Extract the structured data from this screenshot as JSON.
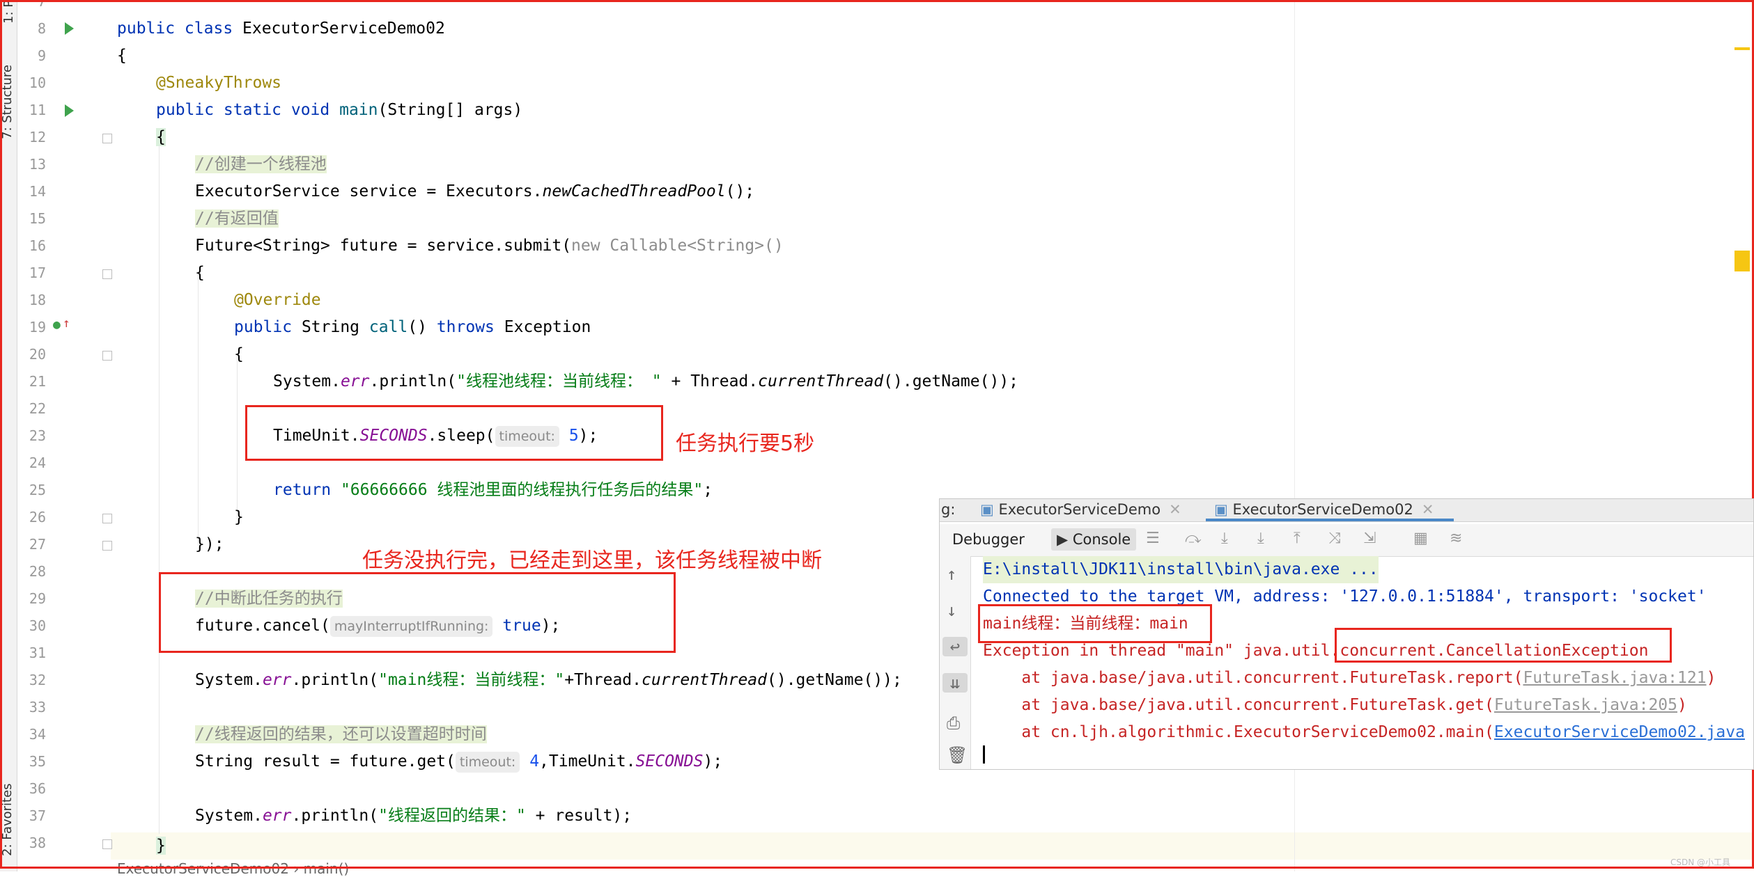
{
  "side_tabs": {
    "project": "1: P",
    "structure": "7: Structure",
    "favorites": "2: Favorites"
  },
  "line_numbers": [
    "7",
    "8",
    "9",
    "10",
    "11",
    "12",
    "13",
    "14",
    "15",
    "16",
    "17",
    "18",
    "19",
    "20",
    "21",
    "22",
    "23",
    "24",
    "25",
    "26",
    "27",
    "28",
    "29",
    "30",
    "31",
    "32",
    "33",
    "34",
    "35",
    "36",
    "37",
    "38"
  ],
  "code": {
    "l8": {
      "kw": "public class ",
      "name": "ExecutorServiceDemo02"
    },
    "l9": "{",
    "l10": "@SneakyThrows",
    "l11": {
      "kw": "public static void ",
      "name": "main",
      "rest": "(String[] args)"
    },
    "l12": "{",
    "l13": "//创建一个线程池",
    "l14": {
      "a": "ExecutorService service = Executors.",
      "b": "newCachedThreadPool",
      "c": "();"
    },
    "l15": "//有返回值",
    "l16": {
      "a": "Future<String> future = service.submit(",
      "b": "new Callable<String>()",
      "c": ""
    },
    "l17": "{",
    "l18": "@Override",
    "l19": {
      "kw": "public ",
      "a": "String ",
      "name": "call",
      "b": "() ",
      "kw2": "throws ",
      "c": "Exception"
    },
    "l20": "{",
    "l21": {
      "a": "System.",
      "b": "err",
      "c": ".println(",
      "str": "\"线程池线程：当前线程： \"",
      "d": " + Thread.",
      "e": "currentThread",
      "f": "().getName());"
    },
    "l23": {
      "a": "TimeUnit.",
      "b": "SECONDS",
      "c": ".sleep(",
      "hint": "timeout:",
      "num": "5",
      "d": ");"
    },
    "l25": {
      "kw": "return ",
      "str": "\"66666666 线程池里面的线程执行任务后的结果\"",
      "d": ";"
    },
    "l26": "}",
    "l27": "});",
    "l29": "//中断此任务的执行",
    "l30": {
      "a": "future.cancel(",
      "hint": "mayInterruptIfRunning:",
      "kw": "true",
      "d": ");"
    },
    "l32": {
      "a": "System.",
      "b": "err",
      "c": ".println(",
      "str": "\"main线程：当前线程：\"",
      "d": "+Thread.",
      "e": "currentThread",
      "f": "().getName());"
    },
    "l34": "//线程返回的结果，还可以设置超时时间",
    "l35": {
      "a": "String result = future.get(",
      "hint": "timeout:",
      "num": "4",
      "c": ",TimeUnit.",
      "b": "SECONDS",
      "d": ");"
    },
    "l37": {
      "a": "System.",
      "b": "err",
      "c": ".println(",
      "str": "\"线程返回的结果：\"",
      "d": " + result);"
    },
    "l38": "}"
  },
  "annotations": {
    "sleep_note": "任务执行要5秒",
    "cancel_note": "任务没执行完，已经走到这里，该任务线程被中断"
  },
  "breadcrumb": "ExecutorServiceDemo02 › main()",
  "debug": {
    "tabs": [
      {
        "label": "ExecutorServiceDemo"
      },
      {
        "label": "ExecutorServiceDemo02"
      }
    ],
    "tab_prefix": "g:",
    "toolbar": {
      "debugger": "Debugger",
      "console": "Console"
    },
    "console_lines": {
      "cmd": "E:\\install\\JDK11\\install\\bin\\java.exe ...",
      "connected": "Connected to the target VM, address: '127.0.0.1:51884', transport: 'socket'",
      "main_thread": "main线程：当前线程：main",
      "exception": "Exception in thread \"main\" java.util.concurrent.CancellationException",
      "at1_a": "    at java.base/java.util.concurrent.FutureTask.report(",
      "at1_link": "FutureTask.java:121",
      "at1_b": ")",
      "at2_a": "    at java.base/java.util.concurrent.FutureTask.get(",
      "at2_link": "FutureTask.java:205",
      "at2_b": ")",
      "at3_a": "    at cn.ljh.algorithmic.ExecutorServiceDemo02.main(",
      "at3_link": "ExecutorServiceDemo02.java"
    }
  },
  "watermark": "CSDN @小工具"
}
